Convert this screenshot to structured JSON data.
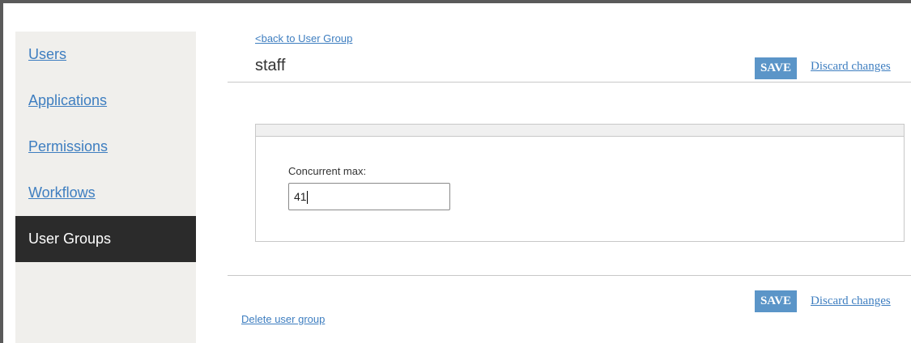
{
  "sidebar": {
    "items": [
      {
        "label": "Users"
      },
      {
        "label": "Applications"
      },
      {
        "label": "Permissions"
      },
      {
        "label": "Workflows"
      },
      {
        "label": "User Groups",
        "active": true
      }
    ]
  },
  "header": {
    "back_link": "<back to User Group",
    "title": "staff"
  },
  "actions": {
    "save_label": "SAVE",
    "discard_label": "Discard changes"
  },
  "form": {
    "concurrent_max_label": "Concurrent max:",
    "concurrent_max_value": "41"
  },
  "footer": {
    "delete_label": "Delete user group"
  },
  "colors": {
    "accent": "#5b95c8",
    "link": "#3e7ec0",
    "active_nav": "#2b2b2b",
    "sidebar_bg": "#f0efec"
  }
}
